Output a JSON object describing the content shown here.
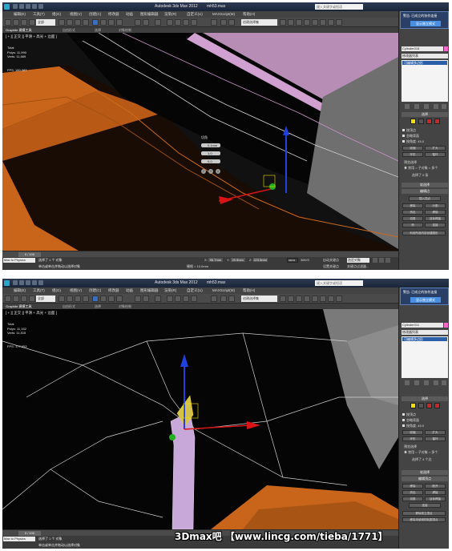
{
  "app": {
    "title": "Autodesk 3ds Max  2012",
    "file": "mh53.max",
    "search_placeholder": "键入关键字或短语",
    "menus": [
      "编辑(E)",
      "工具(T)",
      "组(G)",
      "视图(V)",
      "创建(C)",
      "修改器",
      "动画",
      "图形编辑器",
      "渲染(R)",
      "自定义(U)",
      "MAXScript(M)",
      "帮助(H)"
    ],
    "selection_filter": "全部",
    "named_set": "创建选择集",
    "ribbon_tabs": [
      "Graphite 建模工具",
      "自由形式",
      "选择",
      "对象绘制"
    ]
  },
  "shot1": {
    "viewport_label": "[ + ][ 正交 ][ 平滑 + 高光 + 边面 ]",
    "stats": {
      "header": "Total",
      "polys": "Polys:  11,990",
      "verts": "Verts:  11,669",
      "fps": "FPS:    160.383"
    },
    "popup": {
      "text": "警告: 已成立的协作连接",
      "link": "显示独立模式"
    },
    "object_name": "Cylinder015",
    "modifier_list": "修改器列表",
    "stack_item": "可编辑多边形",
    "selection_rollout": "选择",
    "checkboxes": [
      "按顶点",
      "忽略背面",
      "按角度:"
    ],
    "angle_value": "45.0",
    "buttons": {
      "shrink": "收缩",
      "grow": "扩大",
      "ring": "环形",
      "loop": "循环"
    },
    "preview_label": "预览选择",
    "radios": [
      "禁用",
      "子对象",
      "多个"
    ],
    "selected_count": "选择了 0 条",
    "soft_select": "软选择",
    "edit_edges": "编辑边",
    "insert_vertex": "插入顶点",
    "edge_buttons": [
      "移除",
      "分割",
      "挤出",
      "焊接",
      "切角",
      "目标焊接",
      "桥",
      "连接"
    ],
    "create_shape": "利用所选内容创建图形",
    "floating": {
      "title": "切角",
      "v1": "0.1mm",
      "v2": "1.0",
      "v3": "0.0"
    },
    "frame": "0 / 100",
    "script_label": "Max to Physics",
    "status": "选择了 1 个 对象",
    "prompt": "单击或单击并拖动以选择对象",
    "coords": {
      "x": "96.7mm",
      "y": "29.9mm",
      "z": "223.5mm"
    },
    "grid": "栅格 = 10.0mm",
    "auto_key": "自动关键点",
    "set_key": "设置关键点",
    "key_filters": "关键点过滤器...",
    "selected_obj": "选定对象",
    "speed1": "31K/S",
    "speed2": "36K/S",
    "percent": "57%"
  },
  "shot2": {
    "viewport_label": "[ + ][ 正交 ][ 平滑 + 高光 + 边面 ]",
    "stats": {
      "header": "Total",
      "polys": "Polys:  11,152",
      "verts": "Verts:  11,515",
      "fps": "FPS:    177.653"
    },
    "popup": {
      "text": "警告: 已成立的协作连接",
      "link": "显示独立模式"
    },
    "object_name": "Cylinder011",
    "modifier_list": "修改器列表",
    "stack_item": "可编辑多边形",
    "selection_rollout": "选择",
    "checkboxes": [
      "按顶点",
      "忽略背面",
      "按角度:"
    ],
    "angle_value": "45.0",
    "buttons": {
      "shrink": "收缩",
      "grow": "扩大",
      "ring": "环形",
      "loop": "循环"
    },
    "preview_label": "预览选择",
    "radios": [
      "禁用",
      "子对象",
      "多个"
    ],
    "selected_count": "选择了 4 个边",
    "soft_select": "软选择",
    "edit_edges": "编辑顶点",
    "edge_buttons": [
      "移除",
      "断开",
      "挤出",
      "焊接",
      "切角",
      "目标焊接",
      "连接",
      "移除孤立顶点"
    ],
    "create_shape": "移除未使用的贴图顶点",
    "frame": "0 / 100",
    "script_label": "Max to Physics",
    "status": "选择了 1 个 对象",
    "prompt": "单击或单击并拖动以选择对象",
    "watermark": "3Dmax吧 【www.lincg.com/tieba/1771】"
  },
  "colors": {
    "orange": "#c8651a",
    "pink_edge": "#c890c8",
    "gizmo_red": "#d81414",
    "gizmo_blue": "#2040e0",
    "gizmo_green": "#20b020",
    "select_yellow": "#f0e000"
  }
}
